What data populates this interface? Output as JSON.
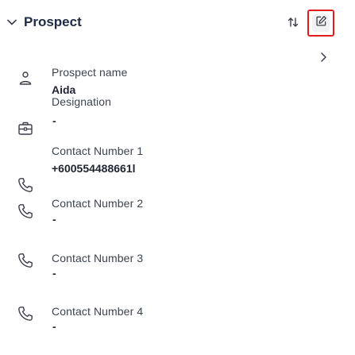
{
  "header": {
    "title": "Prospect",
    "collapse_icon": "chevron-down-icon",
    "swap_icon": "swap-vertical-icon",
    "edit_icon": "edit-square-icon"
  },
  "fields": {
    "prospect_name": {
      "label": "Prospect name",
      "value": "Aida",
      "icon": "user-icon"
    },
    "designation": {
      "label": "Designation",
      "value": "-",
      "icon": "briefcase-icon"
    },
    "contact1": {
      "label": "Contact Number 1",
      "value": "+600554488661l",
      "icon": "phone-icon"
    },
    "contact2": {
      "label": "Contact Number 2",
      "value": "-",
      "icon": "phone-icon"
    },
    "contact3": {
      "label": "Contact Number 3",
      "value": "-",
      "icon": "phone-icon"
    },
    "contact4": {
      "label": "Contact Number 4",
      "value": "-",
      "icon": "phone-icon"
    }
  },
  "colors": {
    "highlight_border": "#e01c1c",
    "text": "#1f2430",
    "icon": "#3a3f4b"
  }
}
